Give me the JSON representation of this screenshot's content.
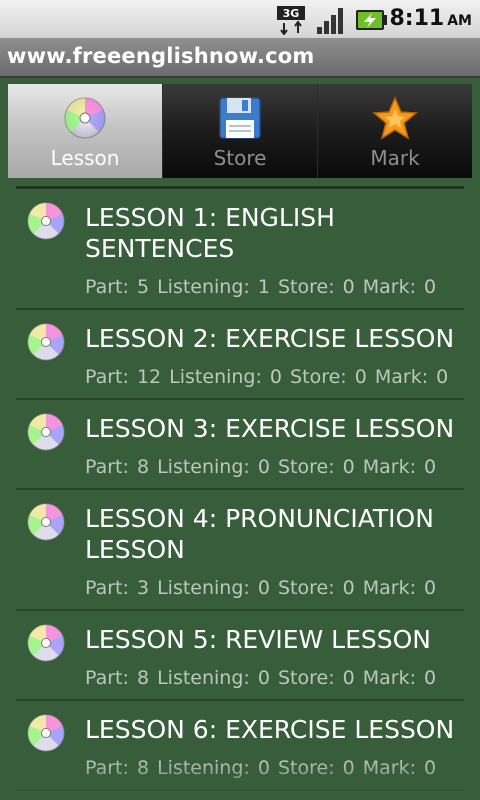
{
  "status_bar": {
    "network": "3G",
    "time": "8:11",
    "ampm": "AM",
    "icons": [
      "3g-data-icon",
      "signal-strength-icon",
      "battery-charging-icon"
    ]
  },
  "title_bar": {
    "title": "www.freeenglishnow.com"
  },
  "tabs": [
    {
      "label": "Lesson",
      "icon": "disc-icon",
      "active": true
    },
    {
      "label": "Store",
      "icon": "floppy-disk-icon",
      "active": false
    },
    {
      "label": "Mark",
      "icon": "star-icon",
      "active": false
    }
  ],
  "lessons": [
    {
      "title": "LESSON 1: ENGLISH SENTENCES",
      "meta": "Part: 5  Listening: 1  Store: 0  Mark: 0"
    },
    {
      "title": "LESSON 2: EXERCISE LESSON",
      "meta": "Part: 12  Listening: 0  Store: 0  Mark: 0"
    },
    {
      "title": "LESSON 3: EXERCISE LESSON",
      "meta": "Part: 8  Listening: 0  Store: 0  Mark: 0"
    },
    {
      "title": "LESSON 4: PRONUNCIATION LESSON",
      "meta": "Part: 3  Listening: 0  Store: 0  Mark: 0"
    },
    {
      "title": "LESSON 5: REVIEW LESSON",
      "meta": "Part: 8  Listening: 0  Store: 0  Mark: 0"
    },
    {
      "title": "LESSON 6: EXERCISE LESSON",
      "meta": "Part: 8  Listening: 0  Store: 0  Mark: 0"
    }
  ],
  "colors": {
    "background": "#375d3a",
    "accent_star": "#f39a1c",
    "floppy": "#3c7ccc"
  }
}
